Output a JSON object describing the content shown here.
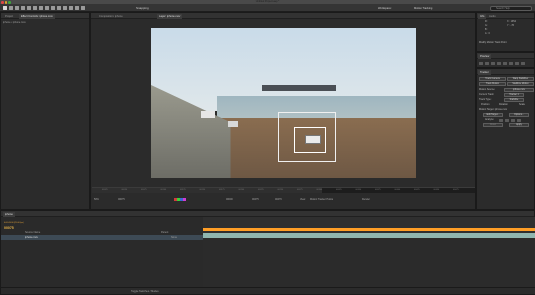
{
  "window": {
    "title": "Untitled Project.aep *"
  },
  "toolbar": {
    "snapping_label": "Snapping",
    "workspace_label": "Workspace:",
    "workspace_value": "Motion Tracking",
    "search_placeholder": "Search Help"
  },
  "left_panel": {
    "tabs": [
      "Project",
      "Effect Controls: iphone.mov"
    ],
    "subtitle": "iphone • iphone.mov"
  },
  "viewer": {
    "tabs": [
      "Composition: iphone",
      "Layer: iphone.mov"
    ],
    "ruler_ticks": [
      "00025",
      "00050",
      "00075",
      "00100",
      "00125",
      "00150",
      "00175",
      "00200",
      "00225",
      "00250",
      "00275",
      "00300",
      "00325",
      "00350",
      "00375",
      "00400",
      "00425",
      "00450",
      "00475"
    ],
    "zoom": "50%",
    "current_time": "00075",
    "start_time": "00000",
    "end_time": "00475",
    "duration": "00476",
    "view_label": "View:",
    "view_value": "Motion Tracker Points",
    "render_label": "Render",
    "colors": {
      "swatch1": "#d13b3b",
      "swatch2": "#3ad13b",
      "swatch3": "#3b6bd1",
      "swatch4": "#d13bd1"
    }
  },
  "info_panel": {
    "tabs": [
      "Info",
      "Audio"
    ],
    "lines": [
      "R :",
      "G :",
      "B :",
      "A : 0",
      "X : 1354",
      "Y : -76"
    ],
    "status": "Modify Motion Track Point"
  },
  "preview_panel": {
    "tabs": [
      "Preview"
    ]
  },
  "tracker_panel": {
    "tabs": [
      "Tracker"
    ],
    "track_camera": "Track Camera",
    "warp_stabilizer": "Warp Stabilizer",
    "track_motion": "Track Motion",
    "stabilize_motion": "Stabilize Motion",
    "motion_source_label": "Motion Source:",
    "motion_source_value": "iphone.mov",
    "current_track_label": "Current Track:",
    "current_track_value": "Tracker 1",
    "track_type_label": "Track Type:",
    "track_type_value": "Stabilize",
    "position_label": "Position",
    "rotation_label": "Rotation",
    "scale_label": "Scale",
    "motion_target_label": "Motion Target: iphone.mov",
    "edit_target": "Edit Target...",
    "options": "Options...",
    "analyze_label": "Analyze:",
    "reset": "Reset",
    "apply": "Apply"
  },
  "timeline": {
    "tab": "iphone",
    "timecode": "00075",
    "timecode_sub": "0:00:03:00 (25.00 fps)",
    "source_name_header": "Source Name",
    "layer_name": "iphone.mov",
    "parent_header": "Parent",
    "parent_value": "None",
    "toggle_label": "Toggle Switches / Modes",
    "colors": {
      "work_area": "#ff9e26",
      "layer_bar": "#8fb6b0",
      "timecode": "#e8b44a"
    }
  }
}
